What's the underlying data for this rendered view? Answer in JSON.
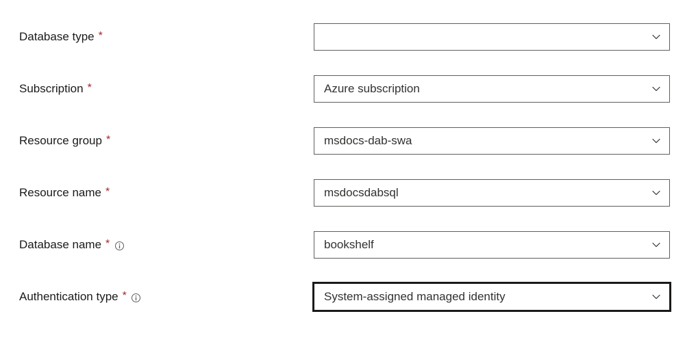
{
  "form": {
    "fields": [
      {
        "key": "database_type",
        "label": "Database type",
        "required": true,
        "info_icon": false,
        "value": "",
        "focused": false
      },
      {
        "key": "subscription",
        "label": "Subscription",
        "required": true,
        "info_icon": false,
        "value": "Azure subscription",
        "focused": false
      },
      {
        "key": "resource_group",
        "label": "Resource group",
        "required": true,
        "info_icon": false,
        "value": "msdocs-dab-swa",
        "focused": false
      },
      {
        "key": "resource_name",
        "label": "Resource name",
        "required": true,
        "info_icon": false,
        "value": "msdocsdabsql",
        "focused": false
      },
      {
        "key": "database_name",
        "label": "Database name",
        "required": true,
        "info_icon": true,
        "value": "bookshelf",
        "focused": false
      },
      {
        "key": "authentication_type",
        "label": "Authentication type",
        "required": true,
        "info_icon": true,
        "value": "System-assigned managed identity",
        "focused": true
      }
    ],
    "required_marker": "*"
  }
}
